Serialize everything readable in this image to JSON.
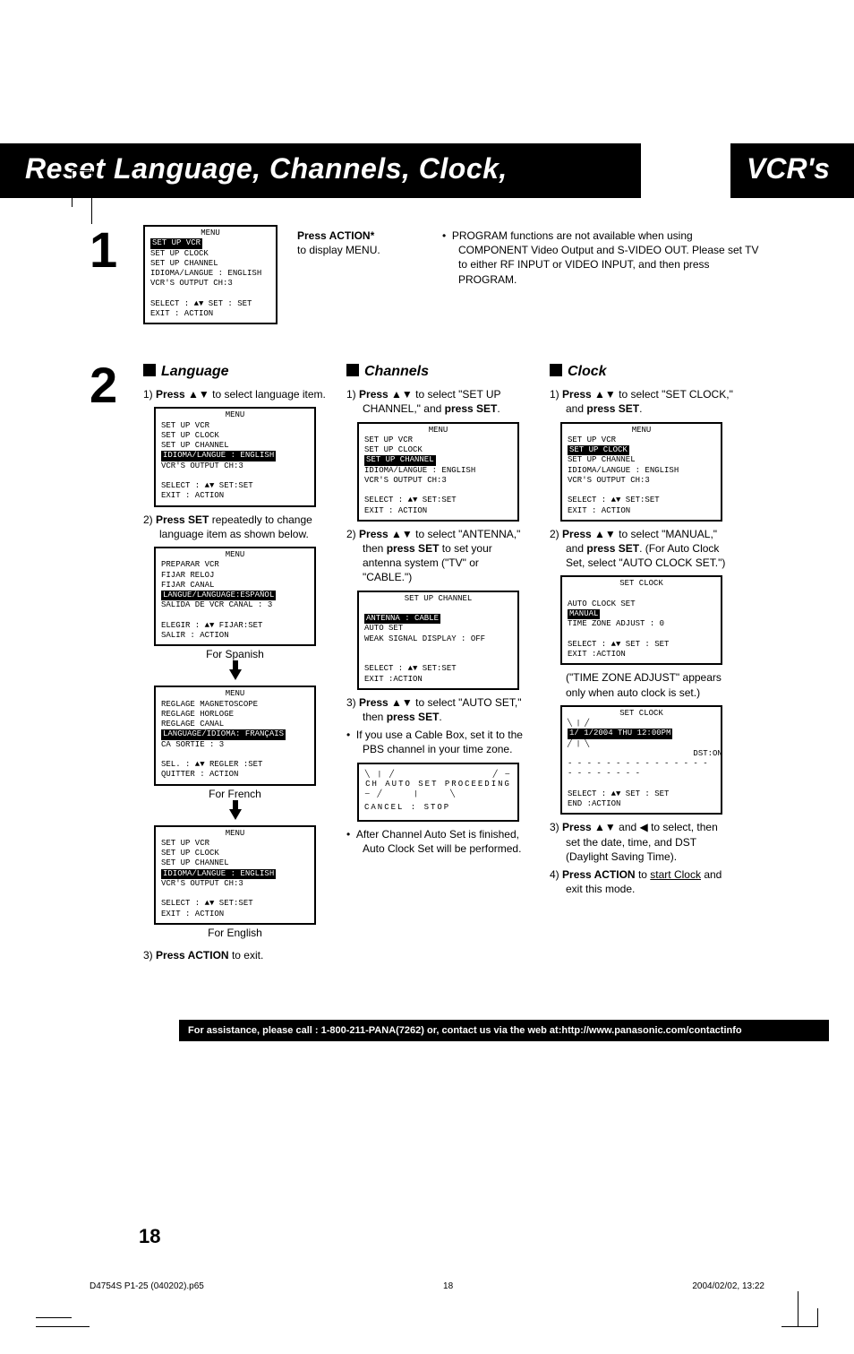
{
  "banner": {
    "left": "Reset Language, Channels, Clock,",
    "right": "VCR's"
  },
  "s1": {
    "num": "1",
    "action": "Press ACTION*",
    "display": "to display MENU.",
    "note": "PROGRAM functions are not available when using COMPONENT Video Output and S-VIDEO OUT. Please set TV to either RF INPUT or VIDEO INPUT, and then press PROGRAM.",
    "osd": {
      "t": "MENU",
      "hl": "SET  UP  VCR",
      "l1": "SET  UP  CLOCK",
      "l2": "SET  UP  CHANNEL",
      "l3": "IDIOMA/LANGUE : ENGLISH",
      "l4": "VCR'S  OUTPUT  CH:3",
      "f1": "SELECT : ▲▼       SET : SET",
      "f2": "EXIT        : ACTION"
    }
  },
  "s2": {
    "num": "2",
    "lang": {
      "title": "Language",
      "p1a": "1)",
      "p1b": "Press ▲▼",
      "p1c": " to select language item.",
      "osd1": {
        "t": "MENU",
        "l1": "SET  UP  VCR",
        "l2": "SET  UP  CLOCK",
        "l3": "SET  UP  CHANNEL",
        "hl": "IDIOMA/LANGUE : ENGLISH",
        "l4": "VCR'S  OUTPUT  CH:3",
        "f1": "SELECT : ▲▼       SET:SET",
        "f2": "EXIT        : ACTION"
      },
      "p2a": "2)",
      "p2b": "Press SET",
      "p2c": " repeatedly to change language item as shown below.",
      "osdES": {
        "t": "MENU",
        "l1": "PREPARAR  VCR",
        "l2": "FIJAR  RELOJ",
        "l3": "FIJAR  CANAL",
        "hl": "LANGUE/LANGUAGE:ESPAÑOL",
        "l4": "SALIDA  DE  VCR  CANAL : 3",
        "f1": "ELEGIR  : ▲▼    FIJAR:SET",
        "f2": "SALIR     : ACTION"
      },
      "capES": "For Spanish",
      "osdFR": {
        "t": "MENU",
        "l1": "REGLAGE  MAGNETOSCOPE",
        "l2": "REGLAGE  HORLOGE",
        "l3": "REGLAGE  CANAL",
        "hl": "LANGUAGE/IDIOMA: FRANÇAIS",
        "l4": "CA  SORTIE : 3",
        "f1": "SEL.        : ▲▼   REGLER :SET",
        "f2": "QUITTER : ACTION"
      },
      "capFR": "For French",
      "osdEN": {
        "t": "MENU",
        "l1": "SET  UP  VCR",
        "l2": "SET  UP  CLOCK",
        "l3": "SET  UP  CHANNEL",
        "hl": "IDIOMA/LANGUE : ENGLISH",
        "l4": "VCR'S  OUTPUT  CH:3",
        "f1": "SELECT : ▲▼       SET:SET",
        "f2": "EXIT        : ACTION"
      },
      "capEN": "For English",
      "p3a": "3)",
      "p3b": "Press ACTION",
      "p3c": " to exit."
    },
    "ch": {
      "title": "Channels",
      "p1a": "1)",
      "p1b": "Press ▲▼",
      "p1c": " to select \"SET UP CHANNEL,\" and ",
      "p1d": "press SET",
      "osd1": {
        "t": "MENU",
        "l1": "SET  UP  VCR",
        "l2": "SET  UP  CLOCK",
        "hl": "SET  UP  CHANNEL",
        "l3": "IDIOMA/LANGUE : ENGLISH",
        "l4": "VCR'S  OUTPUT  CH:3",
        "f1": "SELECT : ▲▼       SET:SET",
        "f2": "EXIT        : ACTION"
      },
      "p2a": "2)",
      "p2b": "Press ▲▼",
      "p2c": " to select \"ANTENNA,\" then ",
      "p2d": "press SET",
      "p2e": " to set your antenna system (\"TV\" or \"CABLE.\")",
      "osd2": {
        "t": "SET  UP  CHANNEL",
        "hl": "ANTENNA     :  CABLE",
        "l1": "AUTO  SET",
        "l2": "WEAK  SIGNAL  DISPLAY : OFF",
        "f1": "SELECT : ▲▼       SET:SET",
        "f2": "EXIT        :ACTION"
      },
      "p3a": "3)",
      "p3b": "Press ▲▼",
      "p3c": " to select \"AUTO SET,\" then ",
      "p3d": "press SET",
      "bul1": "If you use a Cable Box, set it to the PBS channel in your time zone.",
      "osd3": {
        "l1": "CH  AUTO  SET  PROCEEDING",
        "l2": "CANCEL : STOP"
      },
      "bul2": "After Channel Auto Set is finished, Auto Clock Set will be performed."
    },
    "clk": {
      "title": "Clock",
      "p1a": "1)",
      "p1b": "Press ▲▼",
      "p1c": " to select \"SET CLOCK,\" and ",
      "p1d": "press SET",
      "osd1": {
        "t": "MENU",
        "l1": "SET  UP  VCR",
        "hl": "SET  UP  CLOCK",
        "l2": "SET  UP  CHANNEL",
        "l3": "IDIOMA/LANGUE : ENGLISH",
        "l4": "VCR'S  OUTPUT  CH:3",
        "f1": "SELECT : ▲▼       SET:SET",
        "f2": "EXIT        : ACTION"
      },
      "p2a": "2)",
      "p2b": "Press ▲▼",
      "p2c": " to select \"MANUAL,\" and ",
      "p2d": "press SET",
      "p2e": ". (For Auto Clock Set, select \"AUTO CLOCK SET.\")",
      "osd2": {
        "t": "SET  CLOCK",
        "l1": "AUTO  CLOCK  SET",
        "hl": "MANUAL",
        "l2": "TIME  ZONE  ADJUST  :  0",
        "f1": "SELECT  : ▲▼      SET : SET",
        "f2": "EXIT       :ACTION"
      },
      "note": "(\"TIME ZONE ADJUST\" appears only when auto clock is set.)",
      "osd3": {
        "t": "SET  CLOCK",
        "hl": "  1/  1/2004   THU   12:00PM",
        "l1": "                          DST:ON",
        "l2": "- - - - - - - - - - - - - - - - - - - - - - -",
        "f1": "SELECT  : ▲▼      SET : SET",
        "f2": "END        :ACTION"
      },
      "p3a": "3)",
      "p3b": "Press ▲▼",
      "p3c": " and ◀ to select, then set the date, time, and DST (Daylight Saving Time).",
      "p4a": "4)",
      "p4b": "Press ACTION",
      "p4c": " to ",
      "p4d": "start Clock",
      "p4e": " and exit this mode."
    }
  },
  "footer": "For assistance, please call : 1-800-211-PANA(7262) or, contact us via the web at:http://www.panasonic.com/contactinfo",
  "page": "18",
  "meta": {
    "file": "D4754S P1-25 (040202).p65",
    "pg": "18",
    "ts": "2004/02/02, 13:22"
  }
}
